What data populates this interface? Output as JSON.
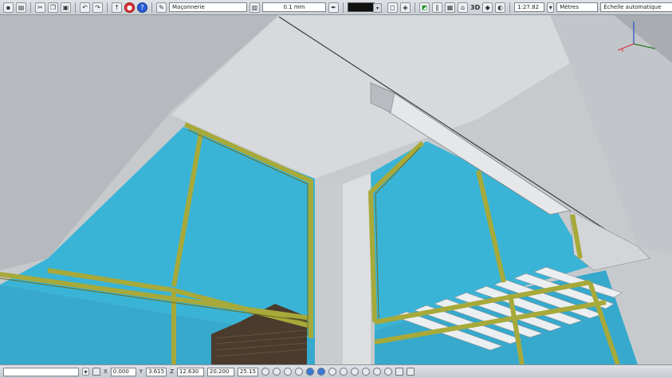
{
  "toolbar": {
    "layer_value": "Maçonnerie",
    "lineweight_value": "0.1 mm",
    "label_3d": "3D",
    "scale_value": "1:27.82",
    "units_value": "Mètres",
    "auto_scale_value": "Échelle automatique"
  },
  "statusbar": {
    "x_label": "X",
    "x_value": "0.000",
    "y_label": "Y",
    "y_value": "3.615",
    "z_label": "Z",
    "z_value": "12.630",
    "length_value": "20.200",
    "angle_value": "25.15"
  },
  "viewport": {
    "axis_colors": {
      "x": "#d8323c",
      "y": "#2b7a2b",
      "z": "#2a47c8"
    },
    "glass_color": "#3ab4d6",
    "frame_color": "#a7a93a",
    "wall_color": "#c8cbce"
  }
}
